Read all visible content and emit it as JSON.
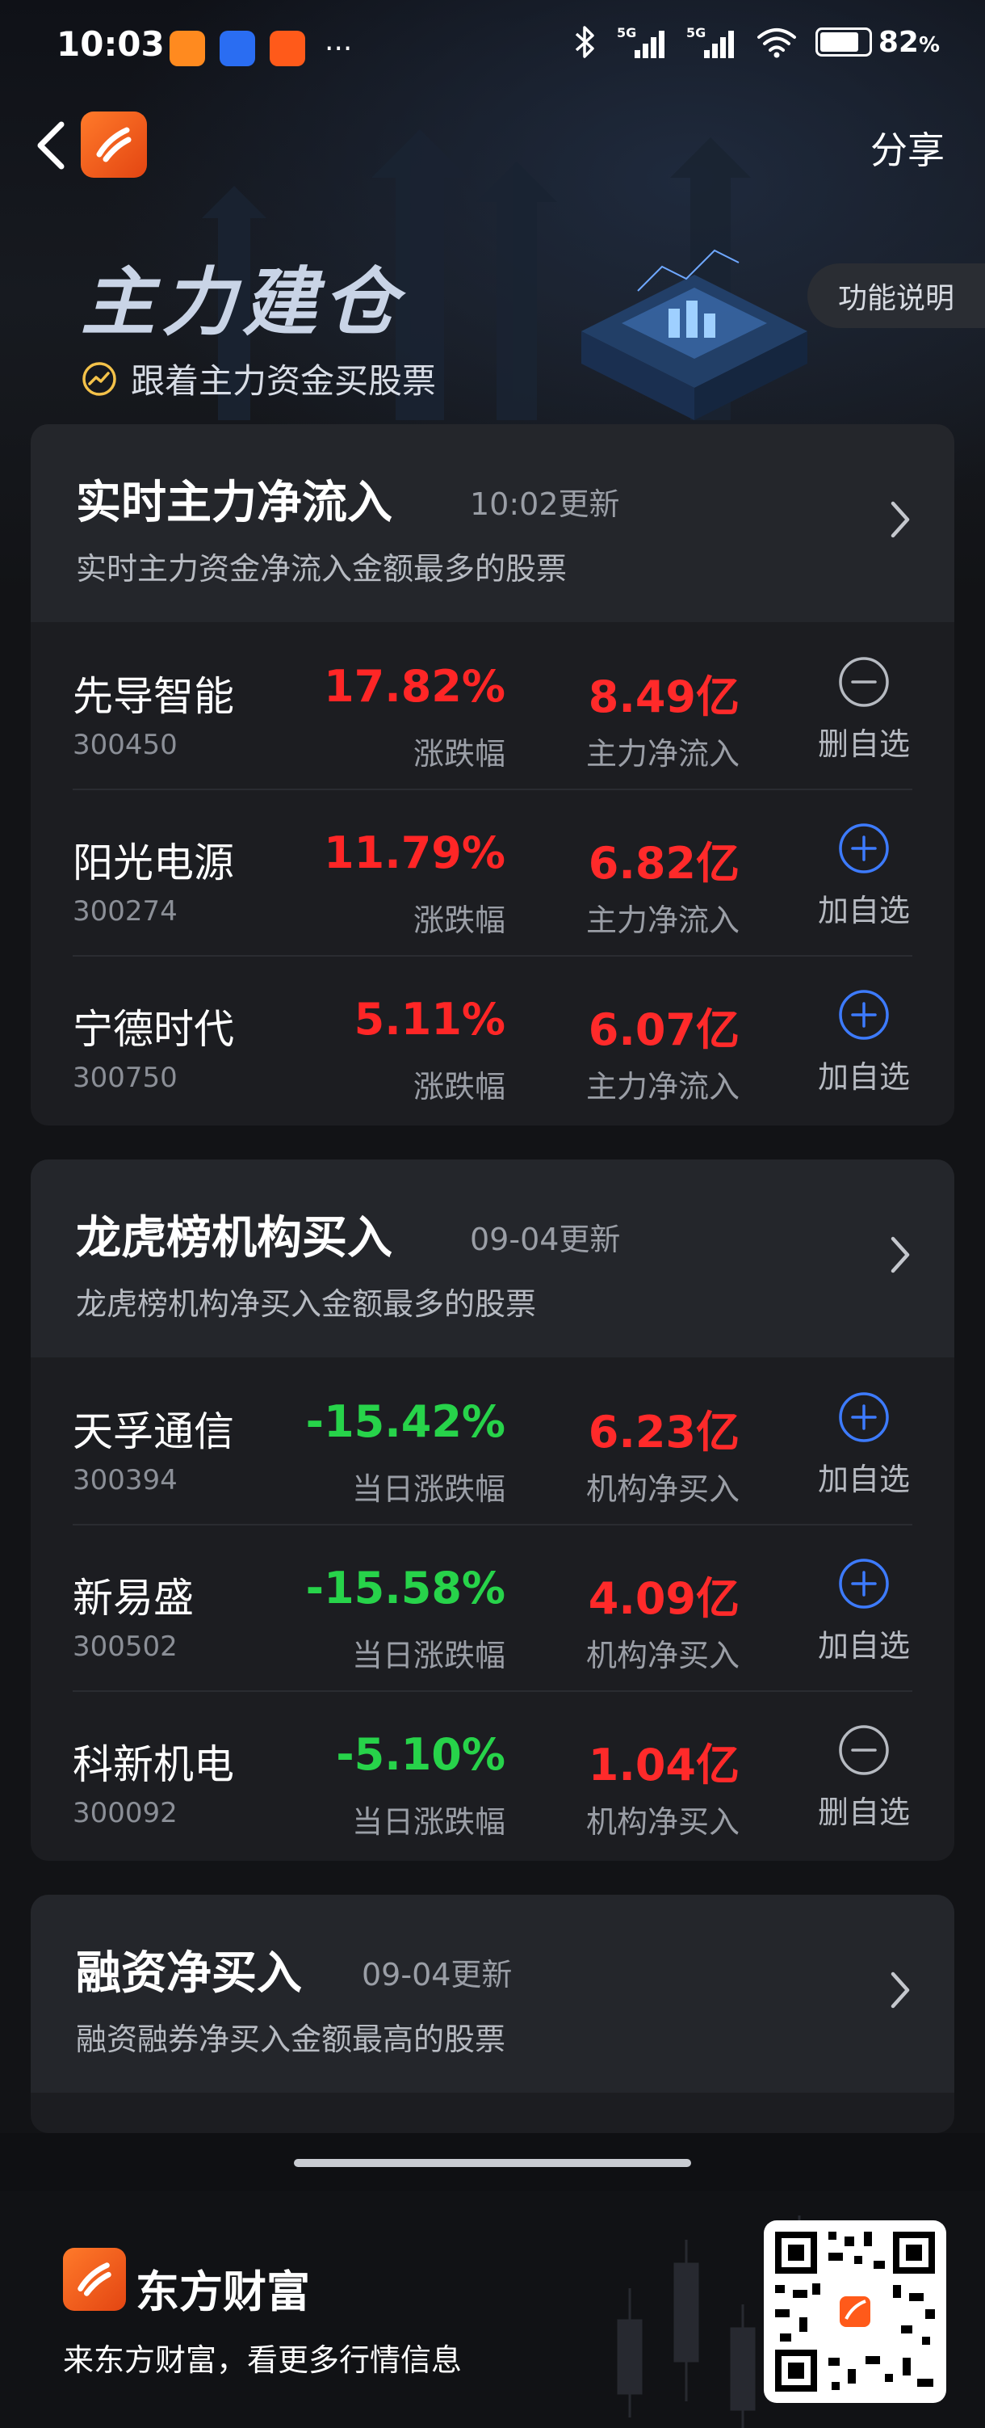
{
  "status_bar": {
    "time": "10:03",
    "more": "···",
    "network": "5G",
    "battery": "82",
    "battery_unit": "%"
  },
  "nav": {
    "share": "分享"
  },
  "hero": {
    "title": "主力建仓",
    "subtitle": "跟着主力资金买股票",
    "func_button": "功能说明"
  },
  "colors": {
    "up": "#ff2626",
    "down": "#27d34a",
    "brand": "#ff5a1a",
    "background": "#121316",
    "card": "#1c1d21"
  },
  "sections": [
    {
      "title": "实时主力净流入",
      "time": "10:02更新",
      "desc": "实时主力资金净流入金额最多的股票",
      "rows": [
        {
          "name": "先导智能",
          "code": "300450",
          "pct": "17.82%",
          "pct_label": "涨跌幅",
          "amount": "8.49亿",
          "amount_label": "主力净流入",
          "action": "删自选",
          "action_icon": "minus-circle-icon"
        },
        {
          "name": "阳光电源",
          "code": "300274",
          "pct": "11.79%",
          "pct_label": "涨跌幅",
          "amount": "6.82亿",
          "amount_label": "主力净流入",
          "action": "加自选",
          "action_icon": "plus-circle-icon"
        },
        {
          "name": "宁德时代",
          "code": "300750",
          "pct": "5.11%",
          "pct_label": "涨跌幅",
          "amount": "6.07亿",
          "amount_label": "主力净流入",
          "action": "加自选",
          "action_icon": "plus-circle-icon"
        }
      ]
    },
    {
      "title": "龙虎榜机构买入",
      "time": "09-04更新",
      "desc": "龙虎榜机构净买入金额最多的股票",
      "rows": [
        {
          "name": "天孚通信",
          "code": "300394",
          "pct": "-15.42%",
          "pct_label": "当日涨跌幅",
          "amount": "6.23亿",
          "amount_label": "机构净买入",
          "action": "加自选",
          "action_icon": "plus-circle-icon"
        },
        {
          "name": "新易盛",
          "code": "300502",
          "pct": "-15.58%",
          "pct_label": "当日涨跌幅",
          "amount": "4.09亿",
          "amount_label": "机构净买入",
          "action": "加自选",
          "action_icon": "plus-circle-icon"
        },
        {
          "name": "科新机电",
          "code": "300092",
          "pct": "-5.10%",
          "pct_label": "当日涨跌幅",
          "amount": "1.04亿",
          "amount_label": "机构净买入",
          "action": "删自选",
          "action_icon": "minus-circle-icon"
        }
      ]
    },
    {
      "title": "融资净买入",
      "time": "09-04更新",
      "desc": "融资融券净买入金额最高的股票"
    }
  ],
  "footer": {
    "brand": "东方财富",
    "slogan": "来东方财富，看更多行情信息"
  }
}
